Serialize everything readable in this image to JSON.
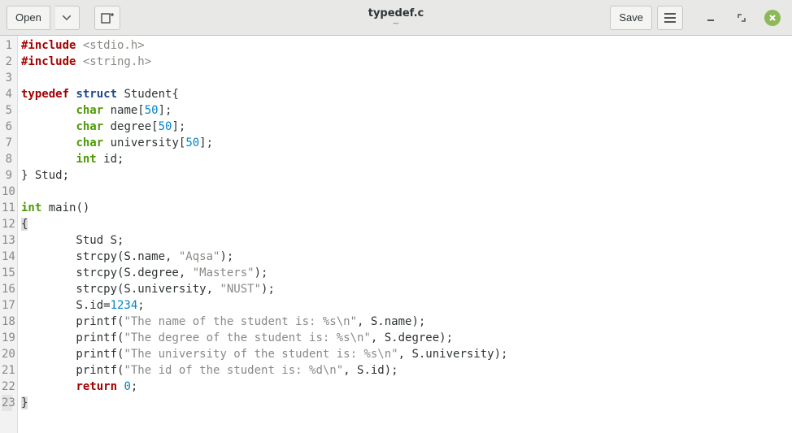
{
  "header": {
    "open_label": "Open",
    "save_label": "Save",
    "title": "typedef.c",
    "subtitle": "~"
  },
  "code": {
    "lines": [
      [
        [
          "pp",
          "#include "
        ],
        [
          "inc",
          "<stdio.h>"
        ]
      ],
      [
        [
          "pp",
          "#include "
        ],
        [
          "inc",
          "<string.h>"
        ]
      ],
      [],
      [
        [
          "kw",
          "typedef "
        ],
        [
          "kw2",
          "struct"
        ],
        [
          "id",
          " Student{"
        ]
      ],
      [
        [
          "id",
          "        "
        ],
        [
          "type",
          "char"
        ],
        [
          "id",
          " name["
        ],
        [
          "num",
          "50"
        ],
        [
          "id",
          "];"
        ]
      ],
      [
        [
          "id",
          "        "
        ],
        [
          "type",
          "char"
        ],
        [
          "id",
          " degree["
        ],
        [
          "num",
          "50"
        ],
        [
          "id",
          "];"
        ]
      ],
      [
        [
          "id",
          "        "
        ],
        [
          "type",
          "char"
        ],
        [
          "id",
          " university["
        ],
        [
          "num",
          "50"
        ],
        [
          "id",
          "];"
        ]
      ],
      [
        [
          "id",
          "        "
        ],
        [
          "type",
          "int"
        ],
        [
          "id",
          " id;"
        ]
      ],
      [
        [
          "id",
          "} Stud;"
        ]
      ],
      [],
      [
        [
          "type",
          "int"
        ],
        [
          "id",
          " main()"
        ]
      ],
      [
        [
          "brh",
          "{"
        ]
      ],
      [
        [
          "id",
          "        Stud S;"
        ]
      ],
      [
        [
          "id",
          "        strcpy(S.name, "
        ],
        [
          "str",
          "\"Aqsa\""
        ],
        [
          "id",
          ");"
        ]
      ],
      [
        [
          "id",
          "        strcpy(S.degree, "
        ],
        [
          "str",
          "\"Masters\""
        ],
        [
          "id",
          ");"
        ]
      ],
      [
        [
          "id",
          "        strcpy(S.university, "
        ],
        [
          "str",
          "\"NUST\""
        ],
        [
          "id",
          ");"
        ]
      ],
      [
        [
          "id",
          "        S.id="
        ],
        [
          "num",
          "1234"
        ],
        [
          "id",
          ";"
        ]
      ],
      [
        [
          "id",
          "        printf("
        ],
        [
          "str",
          "\"The name of the student is: %s\\n\""
        ],
        [
          "id",
          ", S.name);"
        ]
      ],
      [
        [
          "id",
          "        printf("
        ],
        [
          "str",
          "\"The degree of the student is: %s\\n\""
        ],
        [
          "id",
          ", S.degree);"
        ]
      ],
      [
        [
          "id",
          "        printf("
        ],
        [
          "str",
          "\"The university of the student is: %s\\n\""
        ],
        [
          "id",
          ", S.university);"
        ]
      ],
      [
        [
          "id",
          "        printf("
        ],
        [
          "str",
          "\"The id of the student is: %d\\n\""
        ],
        [
          "id",
          ", S.id);"
        ]
      ],
      [
        [
          "id",
          "        "
        ],
        [
          "kw",
          "return "
        ],
        [
          "num",
          "0"
        ],
        [
          "id",
          ";"
        ]
      ],
      [
        [
          "brh",
          "}"
        ]
      ]
    ],
    "current_line": 23
  }
}
